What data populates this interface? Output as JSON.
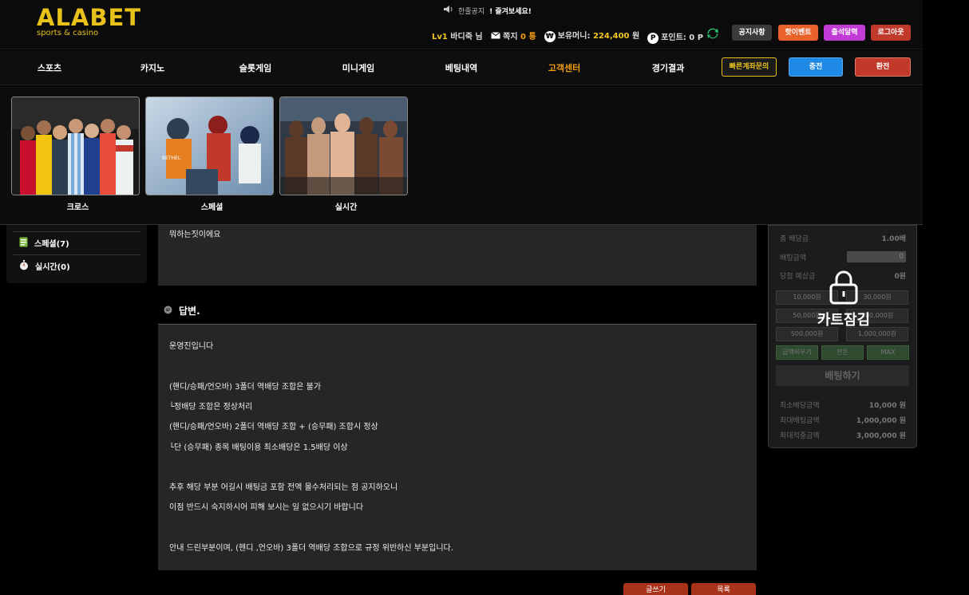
{
  "header": {
    "logo": "ALABET",
    "logo_sub": "sports & casino",
    "notice_label": "한줄공지",
    "notice_msg": "! 즐겨보세요!",
    "level": "Lv1",
    "username": "바디죽 님",
    "message_label": "쪽지",
    "message_count": "0 통",
    "balance_label": "보유머니:",
    "balance": "224,400",
    "balance_unit": "원",
    "point_label": "포인트:",
    "point_value": "0 P",
    "btn_notice": "공지사항",
    "btn_hot_event": "핫이벤트",
    "btn_attendance": "출석달력",
    "btn_logout": "로그아웃"
  },
  "nav": {
    "items": [
      "스포츠",
      "카지노",
      "슬롯게임",
      "미니게임",
      "베팅내역",
      "고객센터",
      "경기결과"
    ],
    "active_index": 5,
    "btn_quick_account": "빠른계좌문의",
    "btn_deposit": "충전",
    "btn_withdraw": "환전"
  },
  "dropdown": {
    "cards": [
      {
        "label": "크로스"
      },
      {
        "label": "스페셜"
      },
      {
        "label": "실시간"
      }
    ]
  },
  "left_panel": {
    "items": [
      {
        "label": "스페셜(7)",
        "icon": "list-icon"
      },
      {
        "label": "실시간(0)",
        "icon": "stopwatch-icon"
      }
    ]
  },
  "question": {
    "text": "뭐하는짓이에요"
  },
  "answer": {
    "title": "답변.",
    "lines": [
      "운영진입니다",
      "",
      "(핸디/승패/언오바) 3폴더 역배당 조합은 불가",
      "└정배당 조합은 정상처리",
      "(핸디/승패/언오바) 2폴더 역배당 조합 + (승무패) 조합시 정상",
      "└단 (승무패) 종목 배팅이용 최소배당은 1.5배당 이상",
      "",
      "추후 해당 부분 어길시 배팅금 포함 전액 몰수처리되는 점 공지하오니",
      "이점 반드시 숙지하시어 피해 보시는 일 없으시기 바랍니다",
      "",
      "안내 드린부분이며, (헨디 ,언오바) 3폴더 역배당 조합으로 규정 위반하신 부분입니다."
    ]
  },
  "cart": {
    "total_odds_label": "총 배당금",
    "total_odds": "1.00배",
    "bet_amount_label": "배팅금액",
    "bet_amount": "0",
    "expected_label": "당첨 예상금",
    "expected": "0원",
    "amount_buttons": [
      "10,000원",
      "30,000원",
      "50,000원",
      "100,000원",
      "500,000원",
      "1,000,000원"
    ],
    "btn_reset": "금액비우기",
    "btn_half": "잔돈",
    "btn_max": "MAX",
    "btn_bet": "배팅하기",
    "min_bet_label": "최소배당금액",
    "min_bet": "10,000 원",
    "max_bet_label": "최대배팅금액",
    "max_bet": "1,000,000 원",
    "max_win_label": "최대적중금액",
    "max_win": "3,000,000 원",
    "lock_text": "카트잠김"
  },
  "footer_buttons": {
    "left": "글쓰기",
    "right": "목록"
  },
  "colors": {
    "brand": "#e8c21a",
    "active_nav": "#f39c12",
    "deposit": "#1e88e5",
    "withdraw": "#c0392b"
  }
}
